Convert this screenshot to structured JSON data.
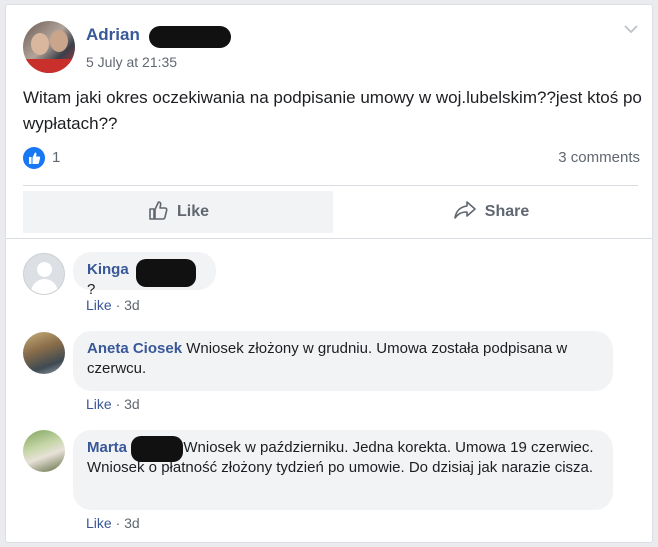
{
  "post": {
    "author_first": "Adrian",
    "timestamp": "5 July at 21:35",
    "text": "Witam jaki okres oczekiwania na podpisanie umowy w woj.lubelskim??jest ktoś po wypłatach??",
    "reactions_count": "1",
    "comments_count": "3 comments",
    "colors": {
      "brand": "#385898",
      "like_badge": "#1877f2"
    }
  },
  "actions": {
    "like_label": "Like",
    "share_label": "Share"
  },
  "comments": [
    {
      "name": "Kinga",
      "text": "?",
      "like_label": "Like",
      "age": "3d"
    },
    {
      "name": "Aneta Ciosek",
      "text": "Wniosek złożony w grudniu. Umowa została podpisana w czerwcu.",
      "like_label": "Like",
      "age": "3d"
    },
    {
      "name": "Marta",
      "text": "Wniosek w październiku. Jedna korekta. Umowa 19 czerwiec. Wniosek o płatność złożony tydzień po umowie. Do dzisiaj jak narazie cisza.",
      "like_label": "Like",
      "age": "3d"
    }
  ],
  "icons": {
    "like": "thumbs-up-icon",
    "share": "share-arrow-icon",
    "options": "chevron-down-icon"
  }
}
